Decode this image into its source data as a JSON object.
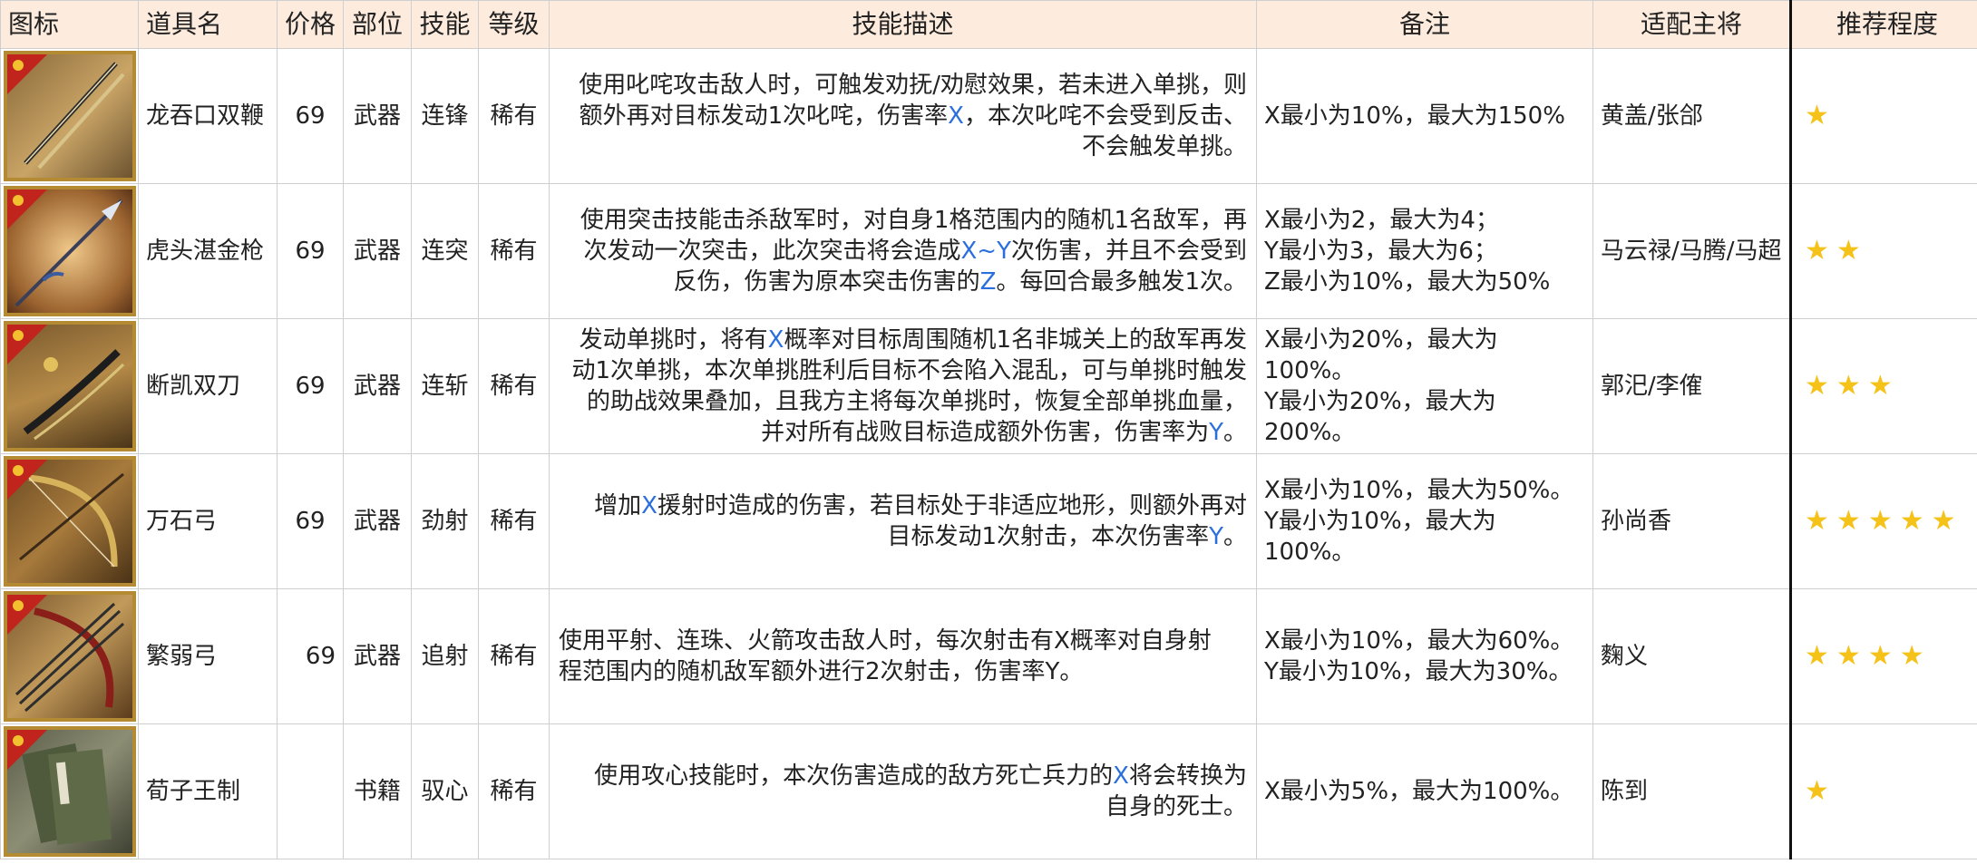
{
  "headers": {
    "icon": "图标",
    "name": "道具名",
    "price": "价格",
    "slot": "部位",
    "skill": "技能",
    "grade": "等级",
    "desc": "技能描述",
    "note": "备注",
    "general": "适配主将",
    "recommend": "推荐程度"
  },
  "rows": [
    {
      "icon": "twin-whips-icon",
      "name": "龙吞口双鞭",
      "price": "69",
      "slot": "武器",
      "skill": "连锋",
      "grade": "稀有",
      "desc": {
        "l1": "使用叱咤攻击敌人时，可触发劝抚/劝慰效果，若未进入单挑，则",
        "l2a": "额外再对目标发动1次叱咤，伤害率",
        "v1": "X",
        "l2b": "，本次叱咤不会受到反击、",
        "l3": "不会触发单挑。"
      },
      "note": [
        "X最小为10%，最大为150%"
      ],
      "general": "黄盖/张郃",
      "stars": 1
    },
    {
      "icon": "spear-icon",
      "name": "虎头湛金枪",
      "price": "69",
      "slot": "武器",
      "skill": "连突",
      "grade": "稀有",
      "desc": {
        "l1": "使用突击技能击杀敌军时，对自身1格范围内的随机1名敌军，再",
        "l2a": "次发动一次突击，此次突击将会造成",
        "v1": "X~Y",
        "l2b": "次伤害，并且不会受到",
        "l3a": "反伤，伤害为原本突击伤害的",
        "v2": "Z",
        "l3b": "。每回合最多触发1次。"
      },
      "note": [
        "X最小为2，最大为4；",
        "Y最小为3，最大为6；",
        "Z最小为10%，最大为50%"
      ],
      "general": "马云禄/马腾/马超",
      "stars": 2
    },
    {
      "icon": "twin-blades-icon",
      "name": "断凯双刀",
      "price": "69",
      "slot": "武器",
      "skill": "连斩",
      "grade": "稀有",
      "desc": {
        "l1a": "发动单挑时，将有",
        "v1": "X",
        "l1b": "概率对目标周围随机1名非城关上的敌军再发",
        "l2": "动1次单挑，本次单挑胜利后目标不会陷入混乱，可与单挑时触发",
        "l3": "的助战效果叠加，且我方主将每次单挑时，恢复全部单挑血量，",
        "l4a": "并对所有战败目标造成额外伤害，伤害率为",
        "v2": "Y",
        "l4b": "。"
      },
      "note": [
        "X最小为20%，最大为100%。",
        "Y最小为20%，最大为200%。"
      ],
      "general": "郭汜/李傕",
      "stars": 3
    },
    {
      "icon": "bow-icon",
      "name": "万石弓",
      "price": "69",
      "slot": "武器",
      "skill": "劲射",
      "grade": "稀有",
      "desc": {
        "l1a": "增加",
        "v1": "X",
        "l1b": "援射时造成的伤害，若目标处于非适应地形，则额外再对",
        "l2a": "目标发动1次射击，本次伤害率",
        "v2": "Y",
        "l2b": "。"
      },
      "note": [
        "X最小为10%，最大为50%。",
        "Y最小为10%，最大为100%。"
      ],
      "general": "孙尚香",
      "stars": 5
    },
    {
      "icon": "bow-arrows-icon",
      "name": "繁弱弓",
      "price": "69",
      "slot": "武器",
      "skill": "追射",
      "grade": "稀有",
      "desc": {
        "l1": "使用平射、连珠、火箭攻击敌人时，每次射击有X概率对自身射",
        "l2": "程范围内的随机敌军额外进行2次射击，伤害率Y。"
      },
      "note": [
        "X最小为10%，最大为60%。",
        "Y最小为10%，最大为30%。"
      ],
      "general": "麴义",
      "stars": 4
    },
    {
      "icon": "book-icon",
      "name": "荀子王制",
      "price": "",
      "slot": "书籍",
      "skill": "驭心",
      "grade": "稀有",
      "desc": {
        "l1a": "使用攻心技能时，本次伤害造成的敌方死亡兵力的",
        "v1": "X",
        "l1b": "将会转换为",
        "l2": "自身的死士。"
      },
      "note": [
        "X最小为5%，最大为100%。"
      ],
      "general": "陈到",
      "stars": 1
    }
  ]
}
